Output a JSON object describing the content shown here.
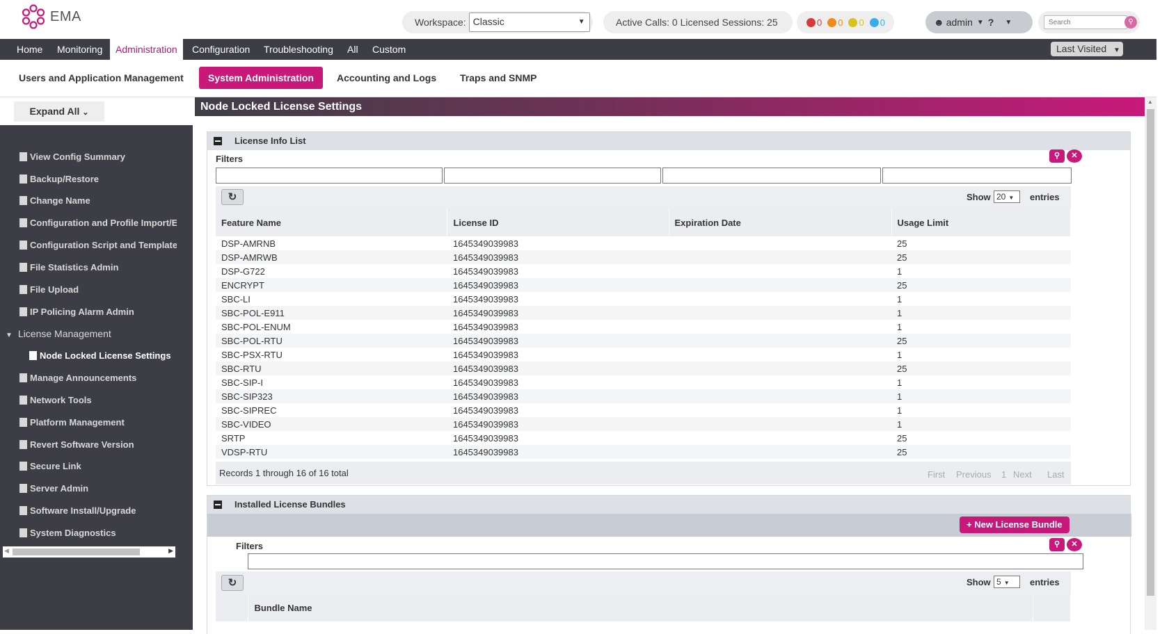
{
  "app": {
    "name": "EMA"
  },
  "header": {
    "workspace_label": "Workspace:",
    "workspace_value": "Classic",
    "status": "Active Calls: 0 Licensed Sessions: 25",
    "alarms": [
      {
        "color": "#d63a3a",
        "count": "0"
      },
      {
        "color": "#f08a1a",
        "count": "0"
      },
      {
        "color": "#d7c21e",
        "count": "0"
      },
      {
        "color": "#3aaee8",
        "count": "0"
      }
    ],
    "user": "admin",
    "help": "?",
    "search_placeholder": "Search"
  },
  "nav": {
    "items": [
      "Home",
      "Monitoring",
      "Administration",
      "Configuration",
      "Troubleshooting",
      "All",
      "Custom"
    ],
    "active": "Administration",
    "last_visited": "Last Visited"
  },
  "subnav": {
    "items": [
      "Users and Application Management",
      "System Administration",
      "Accounting and Logs",
      "Traps and SNMP"
    ],
    "active": "System Administration"
  },
  "sidebar": {
    "expand_all": "Expand All",
    "items": [
      "View Config Summary",
      "Backup/Restore",
      "Change Name",
      "Configuration and Profile Import/Export",
      "Configuration Script and Template",
      "File Statistics Admin",
      "File Upload",
      "IP Policing Alarm Admin"
    ],
    "group": "License Management",
    "active_item": "Node Locked License Settings",
    "items_after": [
      "Manage Announcements",
      "Network Tools",
      "Platform Management",
      "Revert Software Version",
      "Secure Link",
      "Server Admin",
      "Software Install/Upgrade",
      "System Diagnostics"
    ]
  },
  "page": {
    "title": "Node Locked License Settings",
    "license_panel": {
      "title": "License Info List",
      "filters_label": "Filters",
      "show_label": "Show",
      "show_value": "20",
      "entries_label": "entries",
      "columns": [
        "Feature Name",
        "License ID",
        "Expiration Date",
        "Usage Limit"
      ],
      "rows": [
        [
          "DSP-AMRNB",
          "1645349039983",
          "",
          "25"
        ],
        [
          "DSP-AMRWB",
          "1645349039983",
          "",
          "25"
        ],
        [
          "DSP-G722",
          "1645349039983",
          "",
          "1"
        ],
        [
          "ENCRYPT",
          "1645349039983",
          "",
          "25"
        ],
        [
          "SBC-LI",
          "1645349039983",
          "",
          "1"
        ],
        [
          "SBC-POL-E911",
          "1645349039983",
          "",
          "1"
        ],
        [
          "SBC-POL-ENUM",
          "1645349039983",
          "",
          "1"
        ],
        [
          "SBC-POL-RTU",
          "1645349039983",
          "",
          "25"
        ],
        [
          "SBC-PSX-RTU",
          "1645349039983",
          "",
          "1"
        ],
        [
          "SBC-RTU",
          "1645349039983",
          "",
          "25"
        ],
        [
          "SBC-SIP-I",
          "1645349039983",
          "",
          "1"
        ],
        [
          "SBC-SIP323",
          "1645349039983",
          "",
          "1"
        ],
        [
          "SBC-SIPREC",
          "1645349039983",
          "",
          "1"
        ],
        [
          "SBC-VIDEO",
          "1645349039983",
          "",
          "1"
        ],
        [
          "SRTP",
          "1645349039983",
          "",
          "25"
        ],
        [
          "VDSP-RTU",
          "1645349039983",
          "",
          "25"
        ]
      ],
      "records": "Records 1 through 16 of 16 total",
      "pager": [
        "First",
        "Previous",
        "1",
        "Next",
        "Last"
      ]
    },
    "bundle_panel": {
      "title": "Installed License Bundles",
      "new_button": "+ New License Bundle",
      "filters_label": "Filters",
      "show_label": "Show",
      "show_value": "5",
      "entries_label": "entries",
      "columns": [
        "Bundle Name"
      ]
    }
  }
}
